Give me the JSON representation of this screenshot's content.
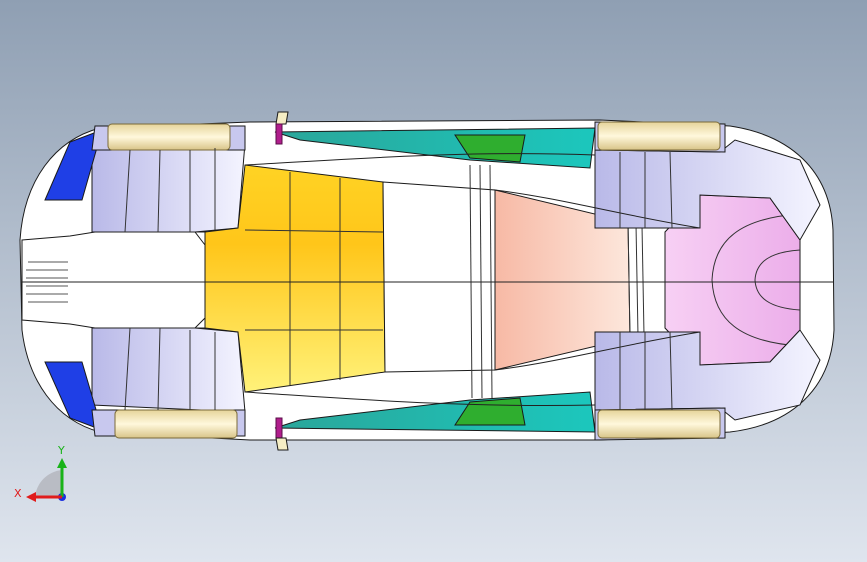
{
  "viewport": {
    "background_top": "#8f9fb3",
    "background_bottom": "#dfe5ee"
  },
  "model": {
    "outline_color": "#1a1a1a",
    "body_fill": "#ffffff",
    "bumper_fill": "#c8c8ee",
    "wheel_fill": "#f0e6b4",
    "wheel_edge": "#c9b878",
    "hood_color_a": "#ffd324",
    "hood_color_b": "#fff27a",
    "roof_color": "#f7c2b0",
    "trunk_color": "#f3bdf2",
    "glass_color": "#1fb5a8",
    "glass_green": "#2fae2f",
    "headlight_color": "#1f3fe6",
    "mirror_color": "#b01e8c"
  },
  "triad": {
    "x_label": "X",
    "y_label": "Y",
    "x_color": "#e01b1b",
    "y_color": "#19b319",
    "z_color": "#1b2fe0"
  }
}
